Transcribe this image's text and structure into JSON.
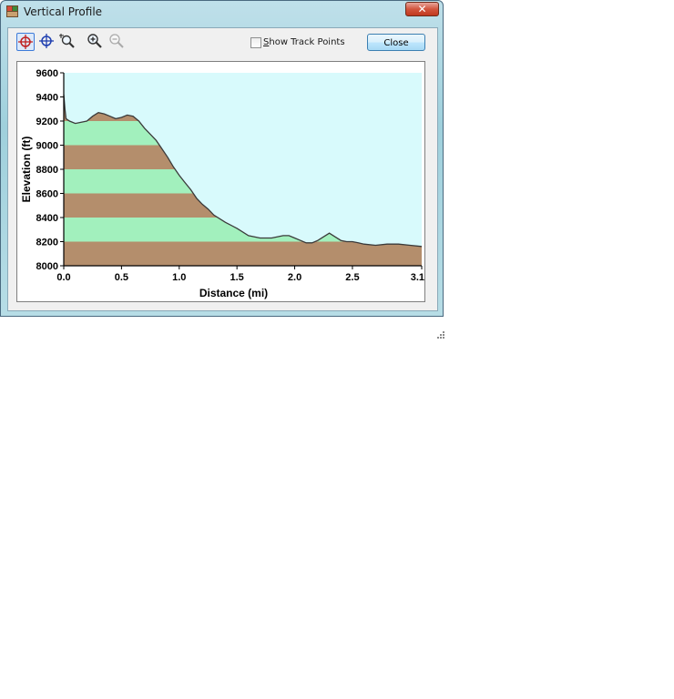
{
  "window": {
    "title": "Vertical Profile"
  },
  "toolbar": {
    "tools": [
      {
        "name": "select-crosshair-tool-icon",
        "active": true
      },
      {
        "name": "pan-crosshair-tool-icon",
        "active": false
      },
      {
        "name": "zoom-region-tool-icon",
        "active": false
      },
      {
        "name": "zoom-in-icon",
        "active": false
      },
      {
        "name": "zoom-out-icon",
        "active": false,
        "disabled": true
      }
    ],
    "show_track_points": {
      "prefix": "S",
      "rest": "how Track Points",
      "checked": false
    },
    "close_label": "Close"
  },
  "colors": {
    "plot_background": "#d8fafc",
    "band_green": "#a2f0bd",
    "band_brown": "#b48e6c",
    "profile_line": "#3a3a3a"
  },
  "chart_data": {
    "type": "area",
    "xlabel": "Distance   (mi)",
    "ylabel": "Elevation  (ft)",
    "xlim": [
      0.0,
      3.1
    ],
    "ylim": [
      8000,
      9600
    ],
    "xticks": [
      "0.0",
      "0.5",
      "1.0",
      "1.5",
      "2.0",
      "2.5",
      "3.1"
    ],
    "xtick_values": [
      0.0,
      0.5,
      1.0,
      1.5,
      2.0,
      2.5,
      3.1
    ],
    "yticks": [
      "8000",
      "8200",
      "8400",
      "8600",
      "8800",
      "9000",
      "9200",
      "9400",
      "9600"
    ],
    "ytick_values": [
      8000,
      8200,
      8400,
      8600,
      8800,
      9000,
      9200,
      9400,
      9600
    ],
    "band_step": 200,
    "series": [
      {
        "x": [
          0.0,
          0.01,
          0.02,
          0.05,
          0.1,
          0.2,
          0.25,
          0.3,
          0.35,
          0.4,
          0.45,
          0.5,
          0.55,
          0.6,
          0.65,
          0.7,
          0.75,
          0.8,
          0.85,
          0.9,
          0.95,
          1.0,
          1.05,
          1.1,
          1.15,
          1.2,
          1.25,
          1.3,
          1.4,
          1.5,
          1.6,
          1.7,
          1.8,
          1.9,
          1.95,
          2.0,
          2.05,
          2.1,
          2.15,
          2.2,
          2.25,
          2.3,
          2.35,
          2.4,
          2.45,
          2.5,
          2.55,
          2.6,
          2.7,
          2.8,
          2.9,
          3.0,
          3.1
        ],
        "y": [
          9420,
          9300,
          9220,
          9200,
          9180,
          9200,
          9240,
          9270,
          9260,
          9240,
          9220,
          9230,
          9250,
          9240,
          9200,
          9140,
          9090,
          9040,
          8970,
          8900,
          8820,
          8750,
          8690,
          8630,
          8560,
          8510,
          8470,
          8420,
          8360,
          8310,
          8250,
          8230,
          8230,
          8250,
          8250,
          8230,
          8210,
          8190,
          8190,
          8210,
          8240,
          8270,
          8240,
          8210,
          8200,
          8200,
          8190,
          8180,
          8170,
          8180,
          8180,
          8170,
          8160
        ]
      }
    ]
  }
}
